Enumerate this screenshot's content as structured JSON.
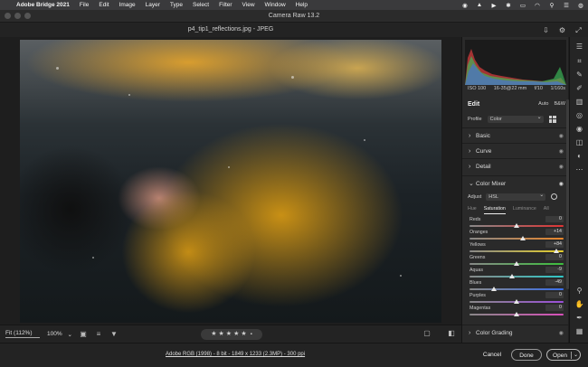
{
  "menubar": {
    "app": "Adobe Bridge 2021",
    "items": [
      "File",
      "Edit",
      "Image",
      "Layer",
      "Type",
      "Select",
      "Filter",
      "View",
      "Window",
      "Help"
    ]
  },
  "window": {
    "title": "Camera Raw 13.2"
  },
  "file": {
    "name": "p4_tip1_reflections.jpg  -  JPEG"
  },
  "bottombar": {
    "fit": "Fit (112%)",
    "zoom": "100%"
  },
  "exif": {
    "iso": "ISO 100",
    "lens": "16-35@22 mm",
    "aperture": "f/10",
    "shutter": "1/160s"
  },
  "edit": {
    "title": "Edit",
    "auto": "Auto",
    "bw": "B&W"
  },
  "profile": {
    "label": "Profile",
    "value": "Color"
  },
  "sections": {
    "basic": "Basic",
    "curve": "Curve",
    "detail": "Detail",
    "color_mixer": "Color Mixer",
    "color_grading": "Color Grading"
  },
  "adjust": {
    "label": "Adjust",
    "value": "HSL"
  },
  "tabs": [
    "Hue",
    "Saturation",
    "Luminance",
    "All"
  ],
  "sliders": [
    {
      "label": "Reds",
      "value": "0",
      "pos": 0.5,
      "gradient": "linear-gradient(90deg,#888,#d33)"
    },
    {
      "label": "Oranges",
      "value": "+14",
      "pos": 0.57,
      "gradient": "linear-gradient(90deg,#888,#e8852a)"
    },
    {
      "label": "Yellows",
      "value": "+84",
      "pos": 0.92,
      "gradient": "linear-gradient(90deg,#888,#e6cf2a)"
    },
    {
      "label": "Greens",
      "value": "0",
      "pos": 0.5,
      "gradient": "linear-gradient(90deg,#888,#3cbf3c)"
    },
    {
      "label": "Aquas",
      "value": "-9",
      "pos": 0.455,
      "gradient": "linear-gradient(90deg,#888,#2fc7c7)"
    },
    {
      "label": "Blues",
      "value": "-49",
      "pos": 0.255,
      "gradient": "linear-gradient(90deg,#888,#3a6ee8)"
    },
    {
      "label": "Purples",
      "value": "0",
      "pos": 0.5,
      "gradient": "linear-gradient(90deg,#888,#9a4fd8)"
    },
    {
      "label": "Magentas",
      "value": "0",
      "pos": 0.5,
      "gradient": "linear-gradient(90deg,#888,#d84fb9)"
    }
  ],
  "status": {
    "link": "Adobe RGB (1998) - 8 bit - 1849 x 1233 (2.3MP) - 300 ppi"
  },
  "buttons": {
    "cancel": "Cancel",
    "done": "Done",
    "open": "Open"
  }
}
